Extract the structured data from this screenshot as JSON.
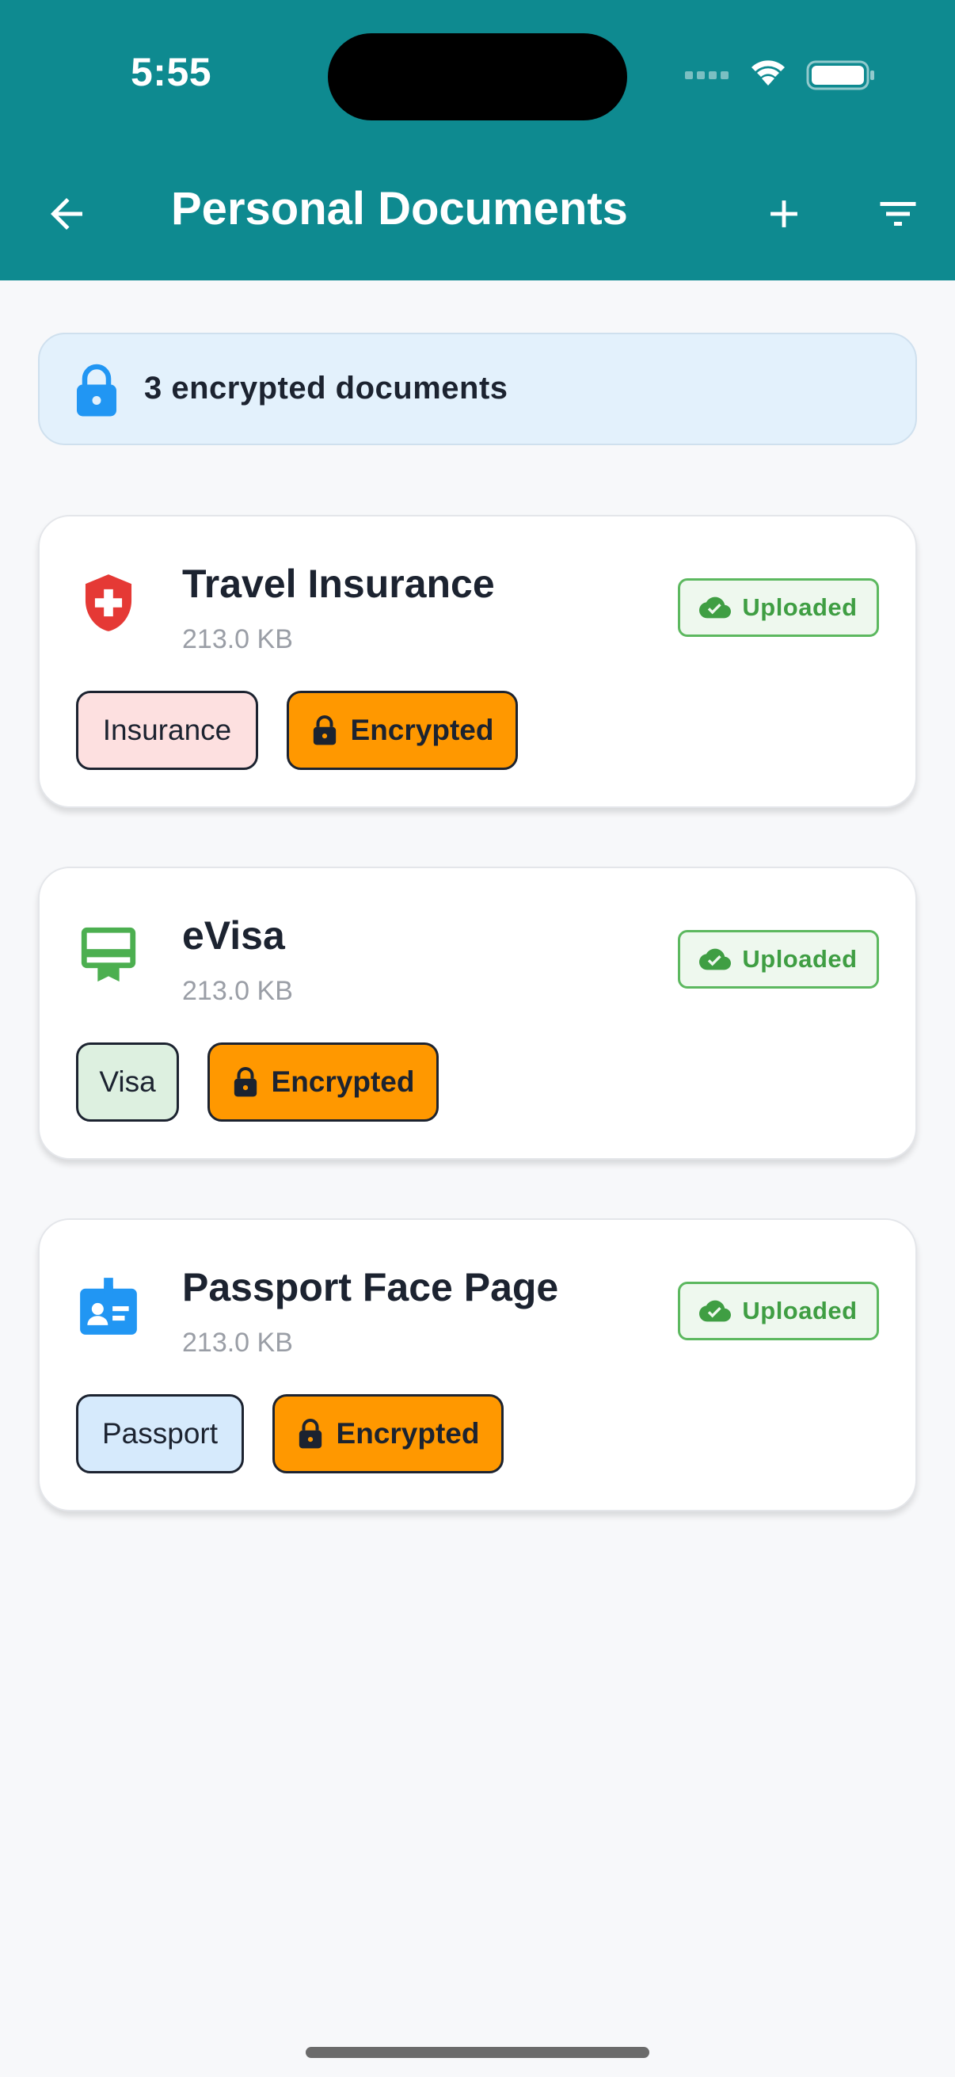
{
  "status_bar": {
    "time": "5:55"
  },
  "nav": {
    "title": "Personal Documents",
    "back_icon": "arrow-left-icon",
    "add_icon": "plus-icon",
    "filter_icon": "filter-icon"
  },
  "banner": {
    "text": "3 encrypted documents",
    "icon": "lock-icon",
    "color": "#2196f3"
  },
  "documents": [
    {
      "title": "Travel Insurance",
      "size": "213.0 KB",
      "status": "Uploaded",
      "category": "Insurance",
      "category_color": "#fde0e0",
      "icon": "shield-plus-icon",
      "icon_color": "#e53935",
      "encryption": "Encrypted"
    },
    {
      "title": "eVisa",
      "size": "213.0 KB",
      "status": "Uploaded",
      "category": "Visa",
      "category_color": "#ddf0e0",
      "icon": "card-membership-icon",
      "icon_color": "#4caf50",
      "encryption": "Encrypted"
    },
    {
      "title": "Passport Face Page",
      "size": "213.0 KB",
      "status": "Uploaded",
      "category": "Passport",
      "category_color": "#d6eafc",
      "icon": "id-badge-icon",
      "icon_color": "#2196f3",
      "encryption": "Encrypted"
    }
  ],
  "colors": {
    "header": "#0e8a90",
    "uploaded": "#3f9e43",
    "encrypted": "#ff9800"
  }
}
